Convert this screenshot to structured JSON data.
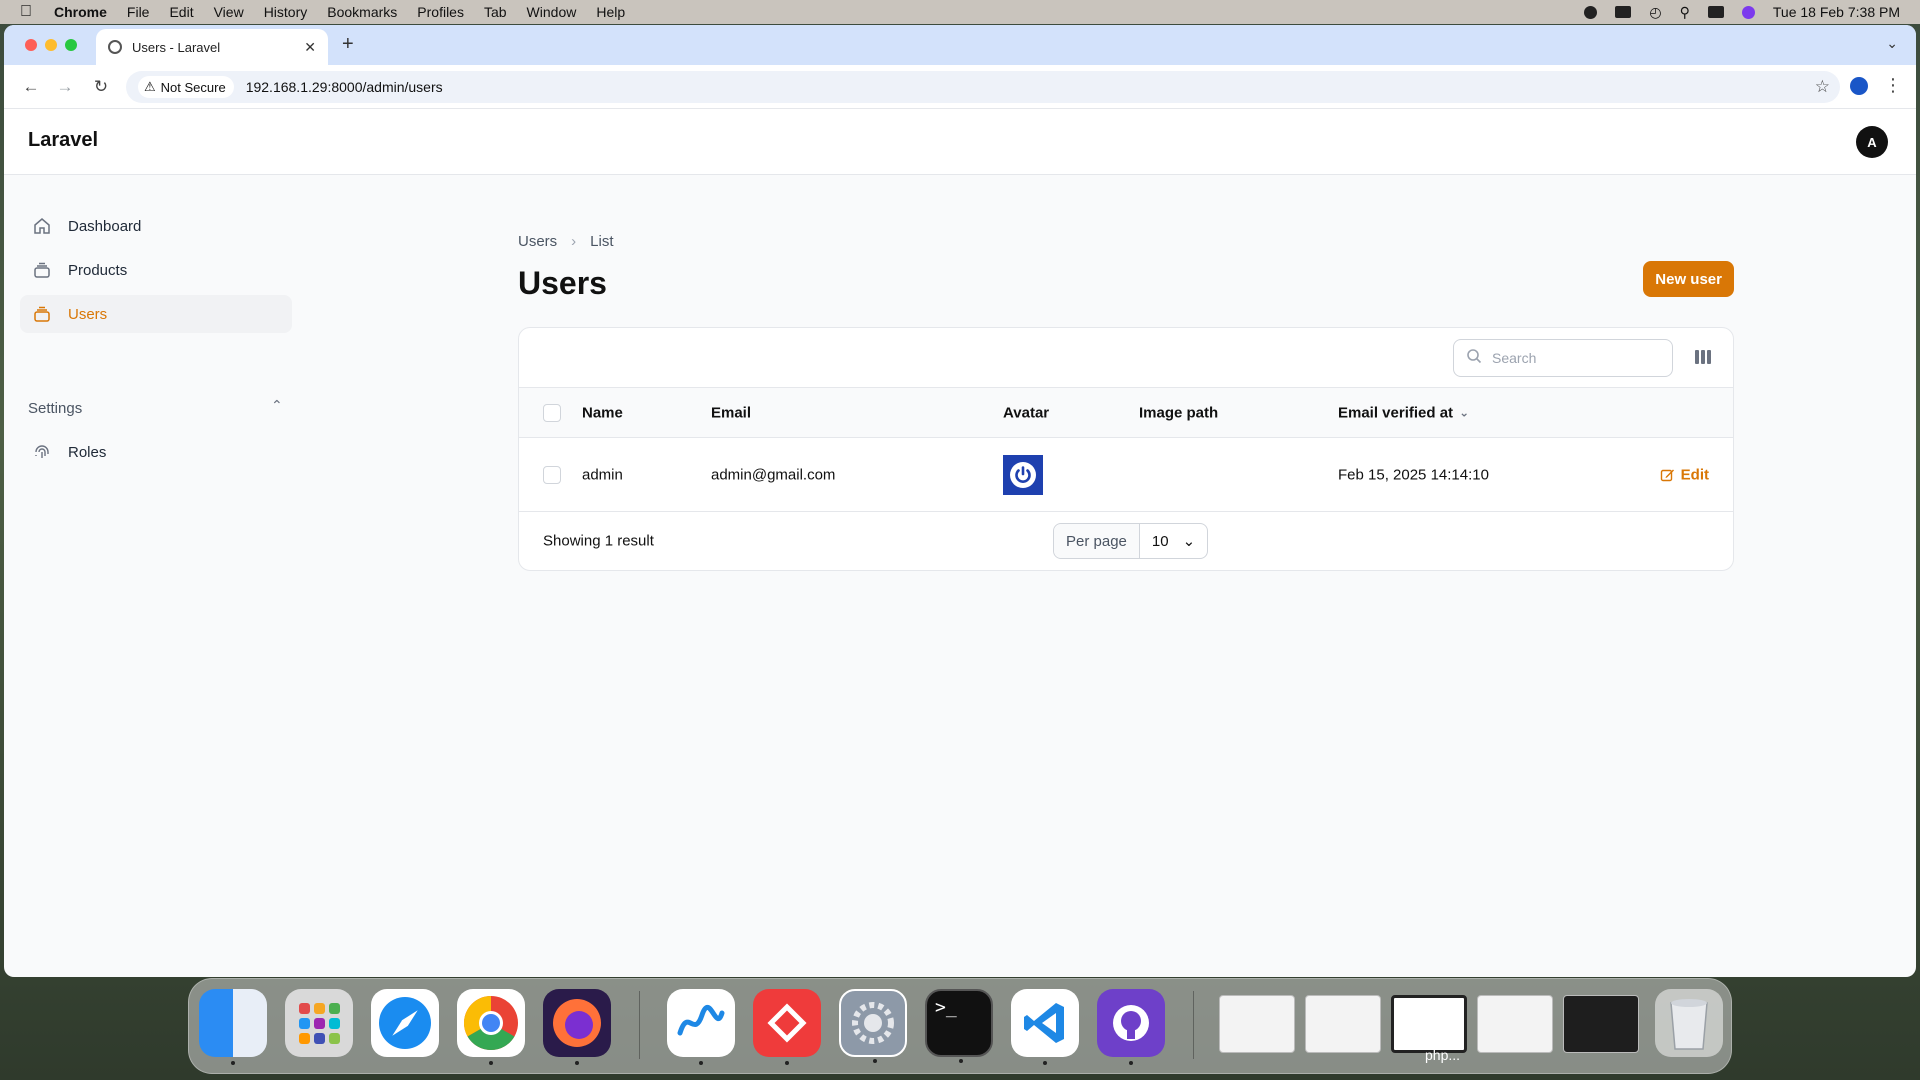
{
  "menubar": {
    "app": "Chrome",
    "items": [
      "File",
      "Edit",
      "View",
      "History",
      "Bookmarks",
      "Profiles",
      "Tab",
      "Window",
      "Help"
    ],
    "clock": "Tue 18 Feb  7:38 PM"
  },
  "browser": {
    "tab_title": "Users - Laravel",
    "security_label": "Not Secure",
    "url": "192.168.1.29:8000/admin/users"
  },
  "app": {
    "brand": "Laravel",
    "user_initial": "A"
  },
  "sidebar": {
    "items": [
      {
        "label": "Dashboard",
        "icon": "home-icon"
      },
      {
        "label": "Products",
        "icon": "stack-icon"
      },
      {
        "label": "Users",
        "icon": "stack-icon",
        "active": true
      }
    ],
    "group_label": "Settings",
    "group_items": [
      {
        "label": "Roles",
        "icon": "fingerprint-icon"
      }
    ]
  },
  "page": {
    "breadcrumb": [
      "Users",
      "List"
    ],
    "title": "Users",
    "new_button": "New user"
  },
  "table": {
    "search_placeholder": "Search",
    "columns": [
      "Name",
      "Email",
      "Avatar",
      "Image path",
      "Email verified at"
    ],
    "rows": [
      {
        "name": "admin",
        "email": "admin@gmail.com",
        "image_path": "",
        "email_verified_at": "Feb 15, 2025 14:14:10",
        "action": "Edit"
      }
    ],
    "summary": "Showing 1 result",
    "per_page_label": "Per page",
    "per_page_value": "10"
  },
  "dock": {
    "window_label": "php..."
  },
  "colors": {
    "primary": "#d97706",
    "avatar_bg": "#1e40af"
  }
}
